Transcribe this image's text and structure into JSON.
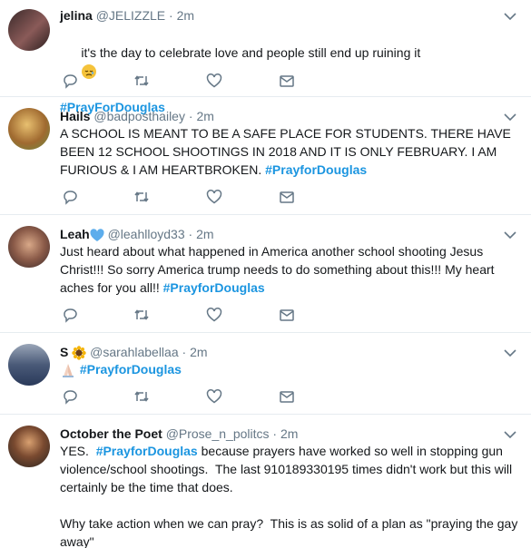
{
  "tweets": [
    {
      "name": "jelina",
      "handle": "@JELIZZLE",
      "time": "2m",
      "text": "it's the day to celebrate love and people still end up ruining it",
      "hashtag": "#PrayForDouglas"
    },
    {
      "name": "Hails",
      "handle": "@badposthailey",
      "time": "2m",
      "text": "A SCHOOL IS MEANT TO BE A SAFE PLACE FOR STUDENTS. THERE HAVE BEEN 12 SCHOOL SHOOTINGS IN 2018 AND IT IS ONLY FEBRUARY. I AM FURIOUS & I AM HEARTBROKEN.",
      "hashtag": "#PrayforDouglas"
    },
    {
      "name": "Leah",
      "handle": "@leahlloyd33",
      "time": "2m",
      "text": "Just heard about what happened in America another school shooting Jesus Christ!!! So sorry America trump needs to do something about this!!! My heart aches for you all!!",
      "hashtag": "#PrayforDouglas"
    },
    {
      "name": "S",
      "handle": "@sarahlabellaa",
      "time": "2m",
      "text": "",
      "hashtag": "#PrayforDouglas"
    },
    {
      "name": "October the Poet",
      "handle": "@Prose_n_politcs",
      "time": "2m",
      "text_before": "YES.",
      "hashtag": "#PrayforDouglas",
      "text_after": "because prayers have worked so well in stopping gun violence/school shootings.  The last 910189330195 times didn't work but this will certainly be the time that does.\n\nWhy take action when we can pray?  This is as solid of a plan as \"praying the gay away\""
    }
  ],
  "dot": "·",
  "icons": [
    "reply-icon",
    "retweet-icon",
    "like-icon",
    "dm-icon",
    "chevron-down-icon",
    "blue-heart-emoji",
    "sunflower-emoji",
    "folded-hands-emoji",
    "sad-face-emoji"
  ],
  "colors": {
    "hashtag": "#1b95e0",
    "meta": "#657786",
    "divider": "#e6ecf0",
    "icon": "#657786"
  }
}
